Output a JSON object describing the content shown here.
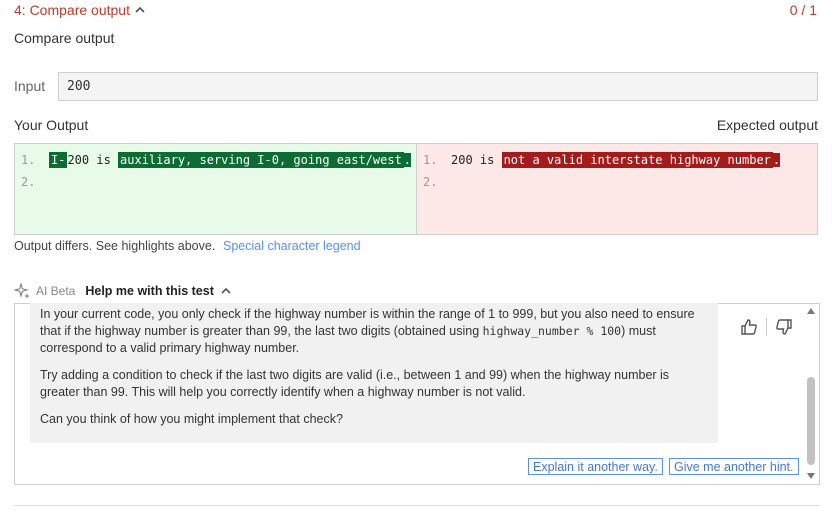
{
  "header": {
    "test_title": "4: Compare output",
    "score": "0 / 1",
    "section_title": "Compare output"
  },
  "input": {
    "label": "Input",
    "value": "200"
  },
  "output": {
    "your_label": "Your Output",
    "expected_label": "Expected output",
    "your_lines": [
      {
        "num": "1.",
        "parts": [
          "I-",
          "200 is ",
          "auxiliary, serving I-0, going east/west",
          "."
        ]
      },
      {
        "num": "2."
      }
    ],
    "expected_lines": [
      {
        "num": "1.",
        "parts": [
          "200 is ",
          "not a valid interstate highway number",
          "."
        ]
      },
      {
        "num": "2."
      }
    ],
    "differs_text": "Output differs. See highlights above.",
    "legend_link": "Special character legend"
  },
  "ai": {
    "beta_label": "AI Beta",
    "help_title": "Help me with this test",
    "para1_a": "In your current code, you only check if the highway number is within the range of 1 to 999, but you also need to ensure that if the highway number is greater than 99, the last two digits (obtained using ",
    "para1_code": "highway_number % 100",
    "para1_b": ") must correspond to a valid primary highway number.",
    "para2": "Try adding a condition to check if the last two digits are valid (i.e., between 1 and 99) when the highway number is greater than 99. This will help you correctly identify when a highway number is not valid.",
    "para3": "Can you think of how you might implement that check?",
    "explain_button": "Explain it another way.",
    "hint_button": "Give me another hint."
  },
  "colors": {
    "accent_red": "#c0392b",
    "diff_green": "#0d6b34",
    "diff_red": "#a31b1b",
    "link_blue": "#5b8ff0"
  }
}
